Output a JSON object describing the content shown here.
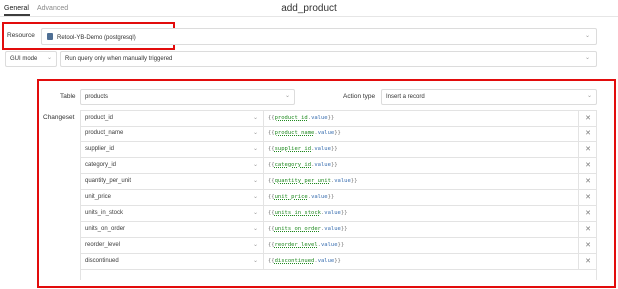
{
  "header": {
    "tabs": [
      {
        "label": "General"
      },
      {
        "label": "Advanced"
      }
    ],
    "title": "add_product"
  },
  "resource": {
    "label": "Resource",
    "value": "Retool-YB-Demo (postgresql)"
  },
  "mode": {
    "gui_label": "GUI mode",
    "trigger_value": "Run query only when manually triggered"
  },
  "query": {
    "table_label": "Table",
    "table_value": "products",
    "action_label": "Action type",
    "action_value": "Insert a record",
    "changeset_label": "Changeset",
    "rows": [
      {
        "key": "product_id",
        "var": "product_id",
        "prop": "value"
      },
      {
        "key": "product_name",
        "var": "product_name",
        "prop": "value"
      },
      {
        "key": "supplier_id",
        "var": "supplier_id",
        "prop": "value"
      },
      {
        "key": "category_id",
        "var": "category_id",
        "prop": "value"
      },
      {
        "key": "quantity_per_unit",
        "var": "quantity_per_unit",
        "prop": "value"
      },
      {
        "key": "unit_price",
        "var": "unit_price",
        "prop": "value"
      },
      {
        "key": "units_in_stock",
        "var": "units_in_stock",
        "prop": "value"
      },
      {
        "key": "units_on_order",
        "var": "units_on_order",
        "prop": "value"
      },
      {
        "key": "reorder_level",
        "var": "reorder_level",
        "prop": "value"
      },
      {
        "key": "discontinued",
        "var": "discontinued",
        "prop": "value"
      }
    ]
  },
  "icons": {
    "dropdown": "chevron-down-icon",
    "delete": "close-icon",
    "database": "database-icon"
  },
  "colors": {
    "highlight": "#e20c0c",
    "variable": "#1f8a1f",
    "property": "#3a6fb0"
  }
}
